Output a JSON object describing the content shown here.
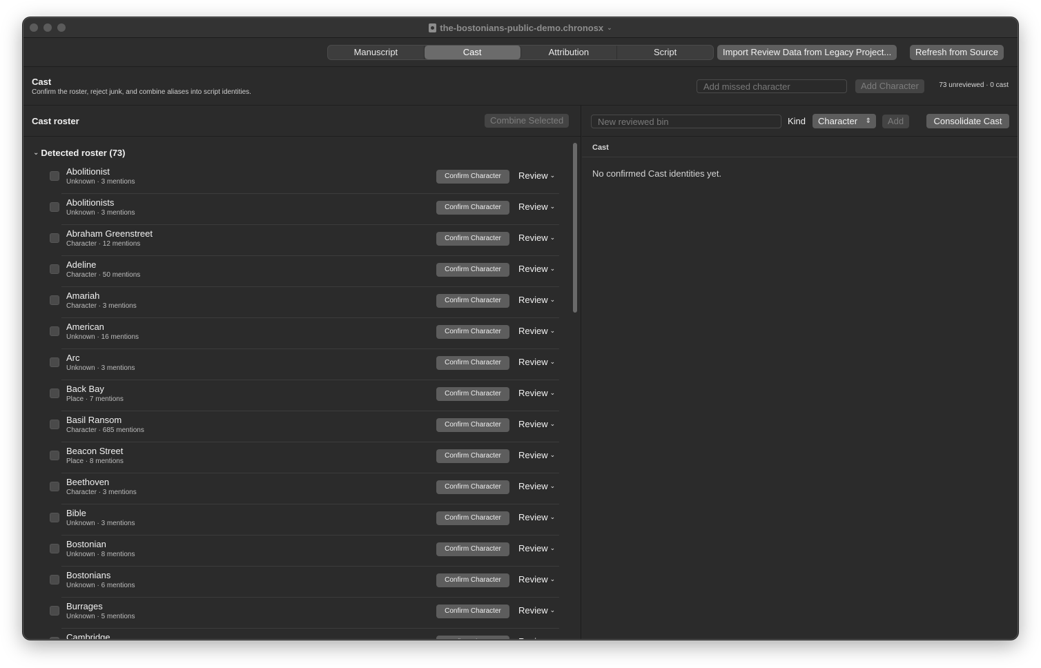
{
  "window": {
    "title": "the-bostonians-public-demo.chronosx",
    "title_chevron": "⌄"
  },
  "toolbar": {
    "tabs": [
      {
        "label": "Manuscript",
        "active": false
      },
      {
        "label": "Cast",
        "active": true
      },
      {
        "label": "Attribution",
        "active": false
      },
      {
        "label": "Script",
        "active": false
      }
    ],
    "import_label": "Import Review Data from Legacy Project...",
    "refresh_label": "Refresh from Source"
  },
  "header": {
    "title": "Cast",
    "subtitle": "Confirm the roster, reject junk, and combine aliases into script identities.",
    "add_missed_placeholder": "Add missed character",
    "add_character_label": "Add Character",
    "count_text": "73 unreviewed · 0 cast"
  },
  "left": {
    "title": "Cast roster",
    "combine_label": "Combine Selected",
    "group_title": "Detected roster (73)",
    "group_chevron": "⌄",
    "confirm_label": "Confirm Character",
    "review_label": "Review",
    "rows": [
      {
        "name": "Abolitionist",
        "meta": "Unknown · 3 mentions"
      },
      {
        "name": "Abolitionists",
        "meta": "Unknown · 3 mentions"
      },
      {
        "name": "Abraham Greenstreet",
        "meta": "Character · 12 mentions"
      },
      {
        "name": "Adeline",
        "meta": "Character · 50 mentions"
      },
      {
        "name": "Amariah",
        "meta": "Character · 3 mentions"
      },
      {
        "name": "American",
        "meta": "Unknown · 16 mentions"
      },
      {
        "name": "Arc",
        "meta": "Unknown · 3 mentions"
      },
      {
        "name": "Back Bay",
        "meta": "Place · 7 mentions"
      },
      {
        "name": "Basil Ransom",
        "meta": "Character · 685 mentions"
      },
      {
        "name": "Beacon Street",
        "meta": "Place · 8 mentions"
      },
      {
        "name": "Beethoven",
        "meta": "Character · 3 mentions"
      },
      {
        "name": "Bible",
        "meta": "Unknown · 3 mentions"
      },
      {
        "name": "Bostonian",
        "meta": "Unknown · 8 mentions"
      },
      {
        "name": "Bostonians",
        "meta": "Unknown · 6 mentions"
      },
      {
        "name": "Burrages",
        "meta": "Unknown · 5 mentions"
      },
      {
        "name": "Cambridge",
        "meta": ""
      }
    ]
  },
  "right": {
    "bin_placeholder": "New reviewed bin",
    "kind_label": "Kind",
    "kind_value": "Character",
    "add_label": "Add",
    "consolidate_label": "Consolidate Cast",
    "column_header": "Cast",
    "empty_message": "No confirmed Cast identities yet."
  }
}
